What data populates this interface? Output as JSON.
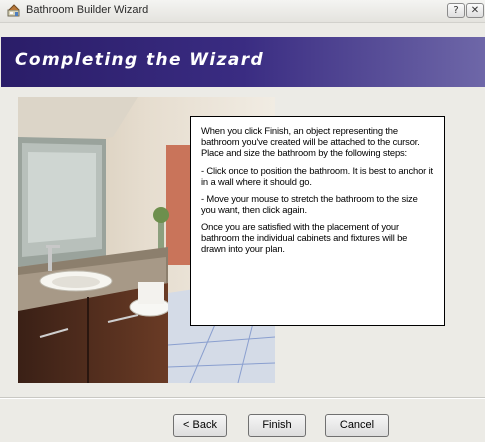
{
  "window": {
    "title": "Bathroom Builder Wizard",
    "icon": "bathroom-builder-app-icon",
    "help_label": "?",
    "close_label": "✕"
  },
  "banner": {
    "title": "Completing the Wizard",
    "colors": {
      "start": "#2a1d68",
      "end": "#6e67a8",
      "text": "#ffffff"
    }
  },
  "illustration": {
    "subject": "bathroom-photo",
    "image_icon": "bathroom-photo-image"
  },
  "instructions": {
    "intro": "When you click Finish, an object representing the bathroom you've created will be attached to the cursor. Place and size the bathroom by the following steps:",
    "steps": [
      "- Click once to position the bathroom. It is best to anchor it in a wall where it should go.",
      "- Move your mouse to stretch the bathroom to the size you want, then click again."
    ],
    "outro": "Once you are satisfied with the placement of your bathroom the individual cabinets and fixtures will be drawn into your plan."
  },
  "buttons": {
    "back": "< Back",
    "finish": "Finish",
    "cancel": "Cancel"
  }
}
